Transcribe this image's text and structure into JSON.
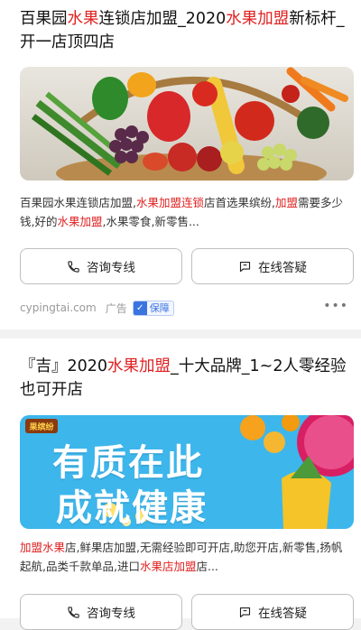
{
  "results": [
    {
      "title_segments": [
        {
          "text": "百果园",
          "hl": false
        },
        {
          "text": "水果",
          "hl": true
        },
        {
          "text": "连锁店加盟_2020",
          "hl": false
        },
        {
          "text": "水果加盟",
          "hl": true
        },
        {
          "text": "新标杆_开一店顶四店",
          "hl": false
        }
      ],
      "desc_segments": [
        {
          "text": "百果园水果连锁店加盟,",
          "hl": false
        },
        {
          "text": "水果加盟连锁",
          "hl": true
        },
        {
          "text": "店首选果缤纷,",
          "hl": false
        },
        {
          "text": "加盟",
          "hl": true
        },
        {
          "text": "需要多少钱,好的",
          "hl": false
        },
        {
          "text": "水果加盟",
          "hl": true
        },
        {
          "text": ",水果零食,新零售...",
          "hl": false
        }
      ],
      "consult_label": "咨询专线",
      "answer_label": "在线答疑",
      "source": "cypingtai.com",
      "ad_label": "广告",
      "guarantee_label": "保障",
      "more_label": "•••"
    },
    {
      "title_segments": [
        {
          "text": "『吉』2020",
          "hl": false
        },
        {
          "text": "水果加盟",
          "hl": true
        },
        {
          "text": "_十大品牌_1~2人零经验也可开店",
          "hl": false
        }
      ],
      "banner_line1": "有质在此",
      "banner_line2": "成就健康",
      "banner_logo": "果缤纷",
      "desc_segments": [
        {
          "text": "加盟水果",
          "hl": true
        },
        {
          "text": "店,鲜果店加盟,无需经验即可开店,助您开店,新零售,扬帆起航,品类千款单品,进口",
          "hl": false
        },
        {
          "text": "水果店加盟",
          "hl": true
        },
        {
          "text": "店...",
          "hl": false
        }
      ],
      "consult_label": "咨询专线",
      "answer_label": "在线答疑"
    }
  ],
  "colors": {
    "highlight": "#e02020",
    "guarantee_blue": "#3a74e0",
    "banner_blue": "#3db6ec"
  },
  "icons": {
    "consult": "phone-icon",
    "answer": "chat-icon",
    "guarantee": "shield-check-icon"
  }
}
